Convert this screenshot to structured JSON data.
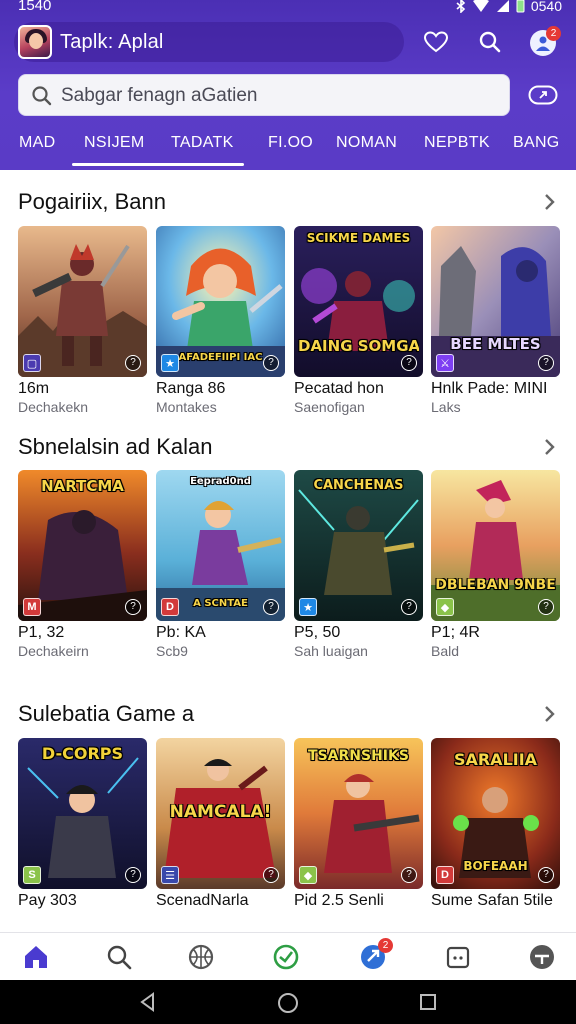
{
  "status_bar": {
    "time": "1540",
    "right_text": "0540"
  },
  "header": {
    "title": "Taplk: Aplal",
    "notification_count": "2",
    "colors": {
      "primary": "#5a3bc6",
      "dark": "#4b2fb4"
    }
  },
  "search": {
    "placeholder": "Sabgar fenagn aGatien"
  },
  "tabs": [
    {
      "label": "MAD"
    },
    {
      "label": "NSIJEM"
    },
    {
      "label": "TADATK"
    },
    {
      "label": "FI.OO"
    },
    {
      "label": "NOMAN"
    },
    {
      "label": "NEPBTK"
    },
    {
      "label": "BANG"
    }
  ],
  "sections": [
    {
      "title": "Pogairiix, Bann",
      "cards": [
        {
          "name": "16m",
          "sub": "Dechakekn",
          "banner": "",
          "icon": "gamepad-badge",
          "badge": "▢"
        },
        {
          "name": "Ranga 86",
          "sub": "Montakes",
          "banner": "AFADEFIIPI IAC",
          "icon": "running-badge",
          "badge": "★"
        },
        {
          "name": "Pecatad hon",
          "sub": "Saenofigan",
          "banner": "DAING SOMGAIL",
          "top_banner": "SCIKME DAMES",
          "icon": "none",
          "badge": ""
        },
        {
          "name": "Hnlk Pade: MINI",
          "sub": "Laks",
          "banner": "BEE MLTES",
          "icon": "sword-badge",
          "badge": "⚔"
        }
      ]
    },
    {
      "title": "Sbnelalsin ad Kalan",
      "cards": [
        {
          "name": "P1, 32",
          "sub": "Dechakeirn",
          "banner": "",
          "top_banner": "NARTCMA",
          "icon": "m-badge",
          "badge": "M"
        },
        {
          "name": "Pb: KA",
          "sub": "Scb9",
          "banner": "A SCNTAE",
          "top_banner": "Eeprad0nd",
          "icon": "d-badge",
          "badge": "D"
        },
        {
          "name": "P5, 50",
          "sub": "Sah luaigan",
          "banner": "",
          "top_banner": "CANCHENAS",
          "icon": "runner-badge",
          "badge": "★"
        },
        {
          "name": "P1; 4R",
          "sub": "Bald",
          "banner": "DBLEBAN 9NBE",
          "icon": "leaf-badge",
          "badge": "◆"
        }
      ]
    },
    {
      "title": "Sulebatia Game a",
      "cards": [
        {
          "name": "Pay 303",
          "sub": "",
          "banner": "",
          "top_banner": "D-CORPS",
          "icon": "s-badge",
          "badge": "S"
        },
        {
          "name": "ScenadNarla",
          "sub": "",
          "banner": "NAMCALA!",
          "icon": "grid-badge",
          "badge": "☰"
        },
        {
          "name": "Pid 2.5 Senli",
          "sub": "",
          "banner": "",
          "top_banner": "TSARNSHIKS",
          "icon": "leaf-badge",
          "badge": "◆"
        },
        {
          "name": "Sume Safan 5tile",
          "sub": "",
          "banner": "BOFEAAH",
          "top_banner": "SARALIIA",
          "icon": "d-badge",
          "badge": "D"
        }
      ]
    }
  ],
  "bottom_nav": {
    "items": [
      {
        "icon": "home-icon"
      },
      {
        "icon": "search-icon"
      },
      {
        "icon": "basketball-icon"
      },
      {
        "icon": "check-circle-icon"
      },
      {
        "icon": "rocket-icon"
      },
      {
        "icon": "calendar-icon"
      },
      {
        "icon": "profile-icon"
      }
    ],
    "badge_count": "2"
  }
}
